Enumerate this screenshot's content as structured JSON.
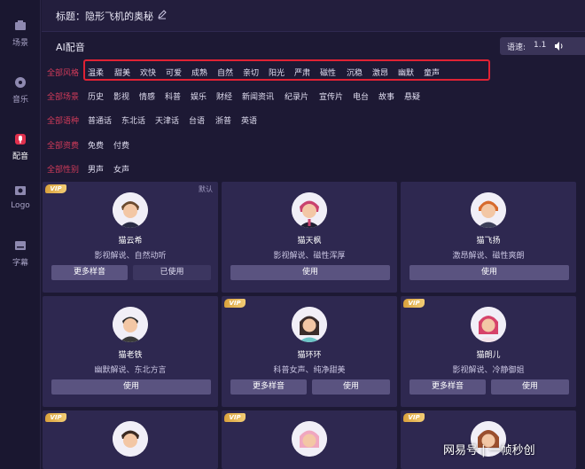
{
  "sidebar": {
    "items": [
      {
        "label": "场景",
        "icon": "scene-icon"
      },
      {
        "label": "音乐",
        "icon": "music-icon"
      },
      {
        "label": "配音",
        "icon": "dubbing-icon"
      },
      {
        "label": "Logo",
        "icon": "logo-icon"
      },
      {
        "label": "字幕",
        "icon": "subtitle-icon"
      }
    ],
    "active_color": "#e0304d"
  },
  "header": {
    "title": "标题：隐形飞机的奥秘",
    "edit_icon": "pencil-icon"
  },
  "voice_panel": {
    "title": "AI配音",
    "speed_label": "语速:",
    "speed_value": "1.1",
    "volume_icon": "speaker-icon"
  },
  "filters": {
    "style": {
      "label": "全部风格",
      "options": [
        "温柔",
        "甜美",
        "欢快",
        "可爱",
        "成熟",
        "自然",
        "亲切",
        "阳光",
        "严肃",
        "磁性",
        "沉稳",
        "激昂",
        "幽默",
        "童声"
      ]
    },
    "scene": {
      "label": "全部场景",
      "options": [
        "历史",
        "影视",
        "情感",
        "科普",
        "娱乐",
        "财经",
        "新闻资讯",
        "纪录片",
        "宣传片",
        "电台",
        "故事",
        "悬疑"
      ]
    },
    "dialect": {
      "label": "全部语种",
      "options": [
        "普通话",
        "东北话",
        "天津话",
        "台语",
        "浙普",
        "英语"
      ]
    },
    "fee": {
      "label": "全部资费",
      "options": [
        "免费",
        "付费"
      ]
    },
    "gender": {
      "label": "全部性别",
      "options": [
        "男声",
        "女声"
      ]
    },
    "highlight_color": "#e02234"
  },
  "cards": [
    {
      "name": "猫云希",
      "desc": "影视解说、自然动听",
      "vip": "VIP",
      "default_tag": "默认",
      "btn_more": "更多样音",
      "btn_use": "已使用"
    },
    {
      "name": "猫天枫",
      "desc": "影视解说、磁性浑厚",
      "btn_use": "使用"
    },
    {
      "name": "猫飞扬",
      "desc": "激昂解说、磁性爽朗",
      "btn_use": "使用"
    },
    {
      "name": "猫老铁",
      "desc": "幽默解说、东北方言",
      "btn_use": "使用"
    },
    {
      "name": "猫环环",
      "desc": "科普女声、纯净甜美",
      "vip": "VIP",
      "btn_more": "更多样音",
      "btn_use": "使用"
    },
    {
      "name": "猫朗儿",
      "desc": "影视解说、冷静御姐",
      "vip": "VIP",
      "btn_more": "更多样音",
      "btn_use": "使用"
    },
    {
      "vip": "VIP"
    },
    {
      "vip": "VIP"
    },
    {
      "vip": "VIP"
    }
  ],
  "watermark": "网易号 | 一帧秒创"
}
